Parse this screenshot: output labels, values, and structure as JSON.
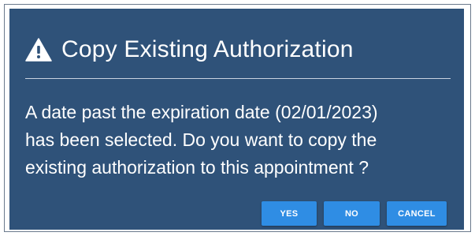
{
  "dialog": {
    "title": "Copy Existing Authorization",
    "title_icon": "warning-icon",
    "message_lines": [
      "A date past the expiration date (02/01/2023)",
      "has been selected. Do you want to copy the",
      "existing authorization to this appointment ?"
    ],
    "buttons": {
      "yes": "YES",
      "no": "NO",
      "cancel": "CANCEL"
    }
  },
  "colors": {
    "dialog_background": "#2f5279",
    "button_background": "#2f8de4",
    "text": "#ffffff"
  }
}
